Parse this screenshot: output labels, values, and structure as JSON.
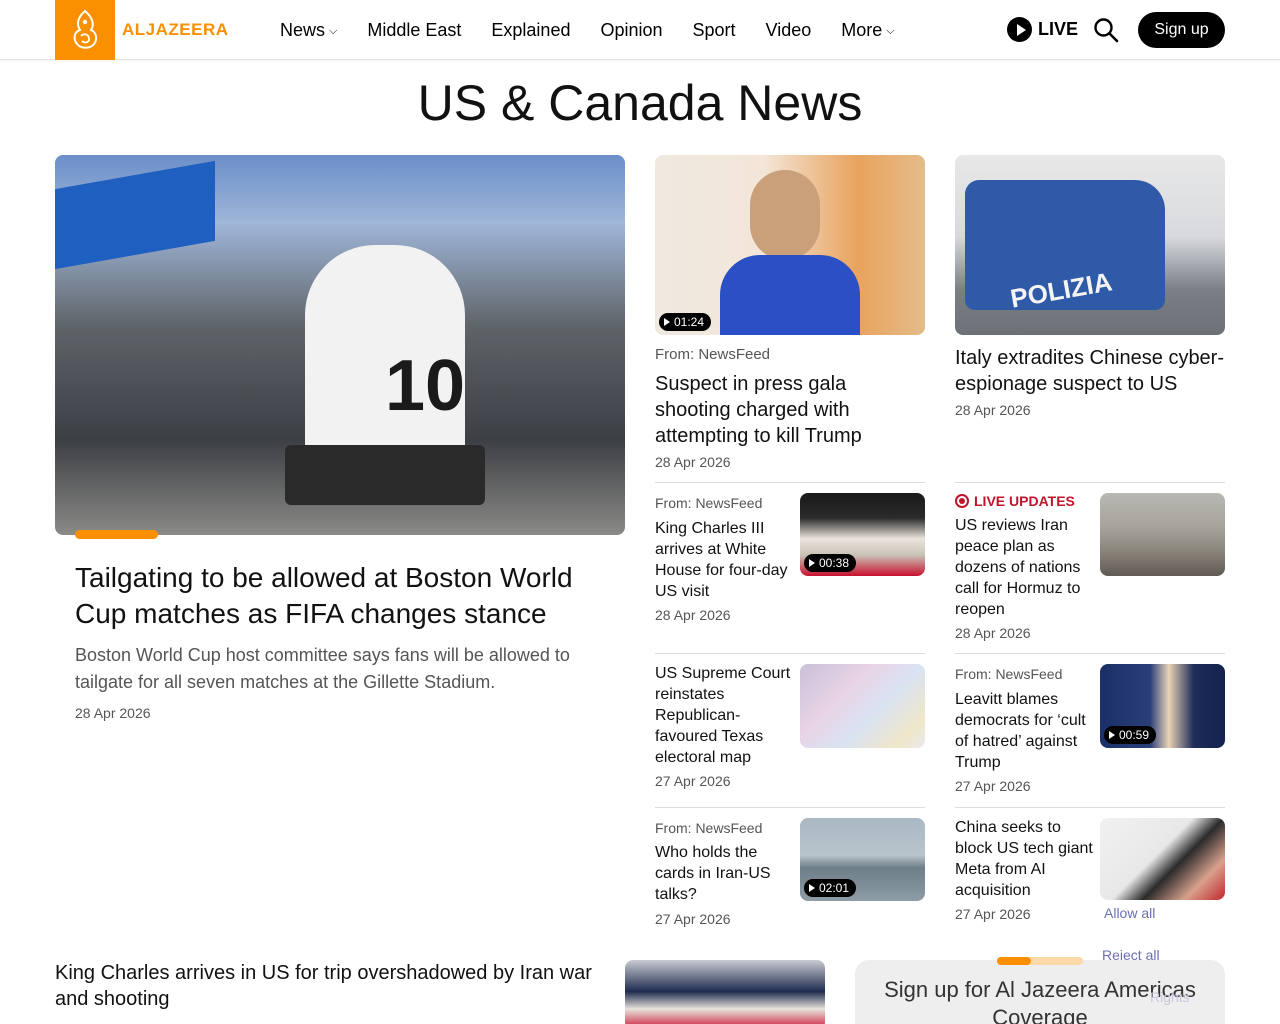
{
  "brand": {
    "name": "ALJAZEERA",
    "color": "#fa9000"
  },
  "nav": [
    {
      "label": "News",
      "dropdown": true
    },
    {
      "label": "Middle East",
      "dropdown": false
    },
    {
      "label": "Explained",
      "dropdown": false
    },
    {
      "label": "Opinion",
      "dropdown": false
    },
    {
      "label": "Sport",
      "dropdown": false
    },
    {
      "label": "Video",
      "dropdown": false
    },
    {
      "label": "More",
      "dropdown": true
    }
  ],
  "header": {
    "live_label": "LIVE",
    "signup_label": "Sign up",
    "search_icon": "search-icon"
  },
  "page": {
    "title": "US & Canada News"
  },
  "feature": {
    "headline": "Tailgating to be allowed at Boston World Cup matches as FIFA changes stance",
    "summary": "Boston World Cup host committee says fans will be allowed to tailgate for all seven matches at the Gillette Stadium.",
    "date": "28 Apr 2026"
  },
  "top_cards": [
    {
      "kicker": "From: NewsFeed",
      "headline": "Suspect in press gala shooting charged with attempting to kill Trump",
      "date": "28 Apr 2026",
      "duration": "01:24"
    },
    {
      "kicker": "",
      "headline": "Italy extradites Chinese cyber-espionage suspect to US",
      "date": "28 Apr 2026",
      "duration": ""
    }
  ],
  "list_left": [
    {
      "kicker": "From: NewsFeed",
      "headline": "King Charles III arrives at White House for four-day US visit",
      "date": "28 Apr 2026",
      "duration": "00:38"
    },
    {
      "kicker": "",
      "headline": "US Supreme Court reinstates Republican-favoured Texas electoral map",
      "date": "27 Apr 2026",
      "duration": ""
    },
    {
      "kicker": "From: NewsFeed",
      "headline": "Who holds the cards in Iran-US talks?",
      "date": "27 Apr 2026",
      "duration": "02:01"
    }
  ],
  "list_right": [
    {
      "kicker": "LIVE UPDATES",
      "headline": "US reviews Iran peace plan as dozens of nations call for Hormuz to reopen",
      "date": "28 Apr 2026",
      "duration": ""
    },
    {
      "kicker": "From: NewsFeed",
      "headline": "Leavitt blames democrats for ‘cult of hatred’ against Trump",
      "date": "27 Apr 2026",
      "duration": "00:59"
    },
    {
      "kicker": "",
      "headline": "China seeks to block US tech giant Meta from AI acquisition",
      "date": "27 Apr 2026",
      "duration": ""
    }
  ],
  "bottom_story": {
    "headline": "King Charles arrives in US for trip overshadowed by Iran war and shooting"
  },
  "newsletter": {
    "title": "Sign up for Al Jazeera Americas Coverage",
    "progress": 0.4
  },
  "cookie": {
    "allow_all": "Allow all",
    "reject_all": "Reject all",
    "rights": "Rights"
  }
}
